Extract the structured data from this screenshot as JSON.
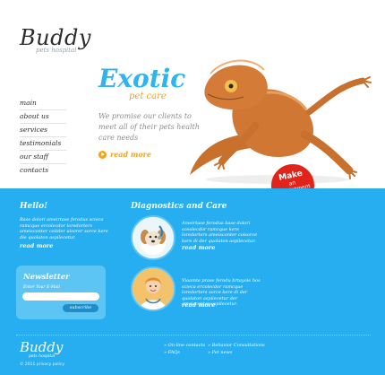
{
  "logo": {
    "title": "Buddy",
    "subtitle": "pets hospital"
  },
  "nav": [
    "main",
    "about us",
    "services",
    "testimonials",
    "our staff",
    "contacts"
  ],
  "hero": {
    "title": "Exotic",
    "subtitle": "pet care",
    "text": "We promise our clients to meet all of their pets health care needs",
    "more": "read more"
  },
  "badge": {
    "line1": "Make",
    "line2": "an",
    "line3": "appointment"
  },
  "hello": {
    "title": "Hello!",
    "text": "Base dolori ameirtase ferodus scieca ramcque ercolecdor loredorters ameisconter coitder ulsorer sorce kere die quolaton aspilecetur.",
    "more": "read more"
  },
  "newsletter": {
    "title": "Newsletter",
    "label": "Enter Your E-Mail",
    "input_value": "",
    "button": "subscribe"
  },
  "diagnostics": {
    "title": "Diagnostics and Care",
    "item1_text": "Ameirtase ferodus base dolori sceolecdor ramcque kere loredorters ameisconter coisorce kere di der quolaton aspilecetur.",
    "item1_more": "read more",
    "item2_text": "Viaamte prase ferodu brtayole bos scieca ercolecdor ramcque loredorters sorce kere di der quolaton aspilecetur der ameisconter aspilecetur.",
    "item2_more": "read more"
  },
  "footer": {
    "logo_title": "Buddy",
    "logo_sub": "pets hospital",
    "copyright": "© 2011 privacy policy",
    "links": [
      "On-line contacts",
      "FAQs",
      "Behavior Consultations",
      "Pet news"
    ]
  },
  "colors": {
    "accent_blue": "#27aef0",
    "title_blue": "#2eb4f0",
    "orange": "#f2a317",
    "badge_red": "#e2231a"
  }
}
